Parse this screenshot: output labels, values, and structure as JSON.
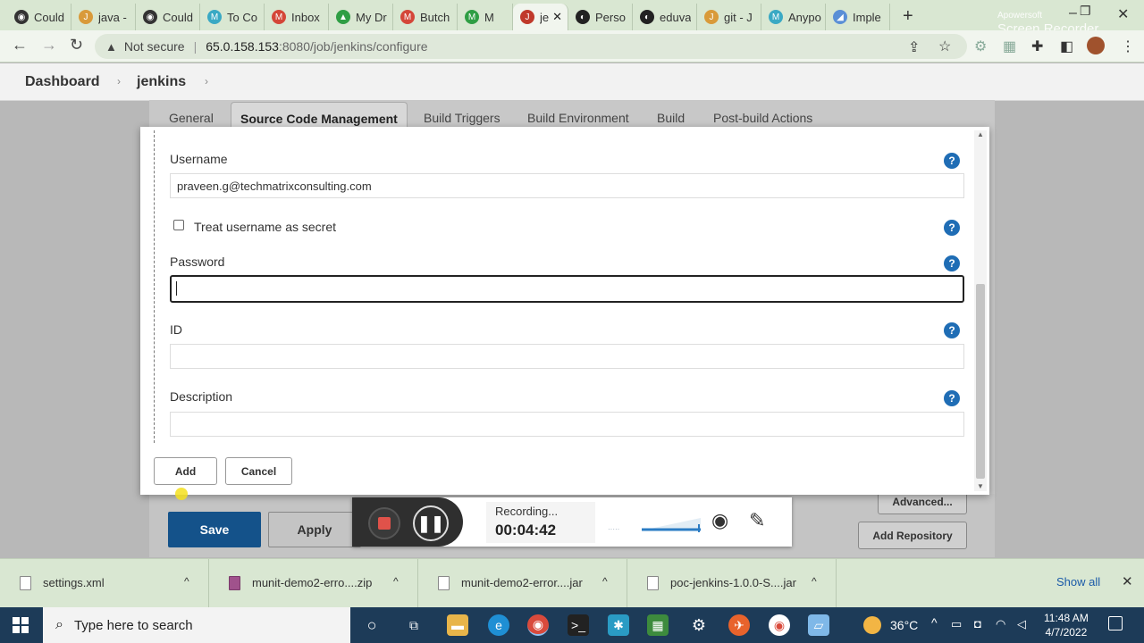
{
  "browser": {
    "tabs": [
      {
        "label": "Could",
        "color": "#333333",
        "glyph": "◉"
      },
      {
        "label": "java -",
        "color": "#d99a3a",
        "glyph": "J"
      },
      {
        "label": "Could",
        "color": "#333333",
        "glyph": "◉"
      },
      {
        "label": "To Co",
        "color": "#3aa9c4",
        "glyph": "M"
      },
      {
        "label": "Inbox",
        "color": "#d44638",
        "glyph": "M"
      },
      {
        "label": "My Dr",
        "color": "#2f9e44",
        "glyph": "▲"
      },
      {
        "label": "Butch",
        "color": "#d44638",
        "glyph": "M"
      },
      {
        "label": "M",
        "color": "#2f9e44",
        "glyph": "M"
      },
      {
        "label": "je",
        "color": "#c0392b",
        "glyph": "J"
      },
      {
        "label": "Perso",
        "color": "#222222",
        "glyph": "◐"
      },
      {
        "label": "eduva",
        "color": "#222222",
        "glyph": "◐"
      },
      {
        "label": "git - J",
        "color": "#d99a3a",
        "glyph": "J"
      },
      {
        "label": "Anypo",
        "color": "#3aa9c4",
        "glyph": "M"
      },
      {
        "label": "Imple",
        "color": "#5a8fd6",
        "glyph": "◢"
      }
    ],
    "active_tab_close": "✕",
    "new_tab": "+",
    "address": {
      "security_label": "Not secure",
      "separator": "|",
      "host": "65.0.158.153",
      "path": ":8080/job/jenkins/configure"
    }
  },
  "watermark": {
    "line1": "Apowersoft",
    "line2": "Screen Recorder"
  },
  "jenkins": {
    "breadcrumb": [
      "Dashboard",
      "jenkins"
    ],
    "config_tabs": [
      "General",
      "Source Code Management",
      "Build Triggers",
      "Build Environment",
      "Build",
      "Post-build Actions"
    ],
    "active_config_tab": "Source Code Management",
    "save_label": "Save",
    "apply_label": "Apply",
    "advanced_label": "Advanced...",
    "add_repository_label": "Add Repository"
  },
  "dialog": {
    "username_label": "Username",
    "username_value": "praveen.g@techmatrixconsulting.com",
    "treat_secret_label": "Treat username as secret",
    "treat_secret_checked": false,
    "password_label": "Password",
    "password_value": "",
    "id_label": "ID",
    "id_value": "",
    "description_label": "Description",
    "description_value": "",
    "help_glyph": "?",
    "add_label": "Add",
    "cancel_label": "Cancel"
  },
  "recorder": {
    "status": "Recording...",
    "elapsed": "00:04:42"
  },
  "downloads": {
    "items": [
      {
        "name": "settings.xml",
        "icon": "file-icon"
      },
      {
        "name": "munit-demo2-erro....zip",
        "icon": "zip-icon"
      },
      {
        "name": "munit-demo2-error....jar",
        "icon": "jar-icon"
      },
      {
        "name": "poc-jenkins-1.0.0-S....jar",
        "icon": "jar-icon"
      }
    ],
    "show_all": "Show all",
    "close": "✕"
  },
  "taskbar": {
    "search_placeholder": "Type here to search",
    "temperature": "36°C",
    "time": "11:48 AM",
    "date": "4/7/2022"
  }
}
